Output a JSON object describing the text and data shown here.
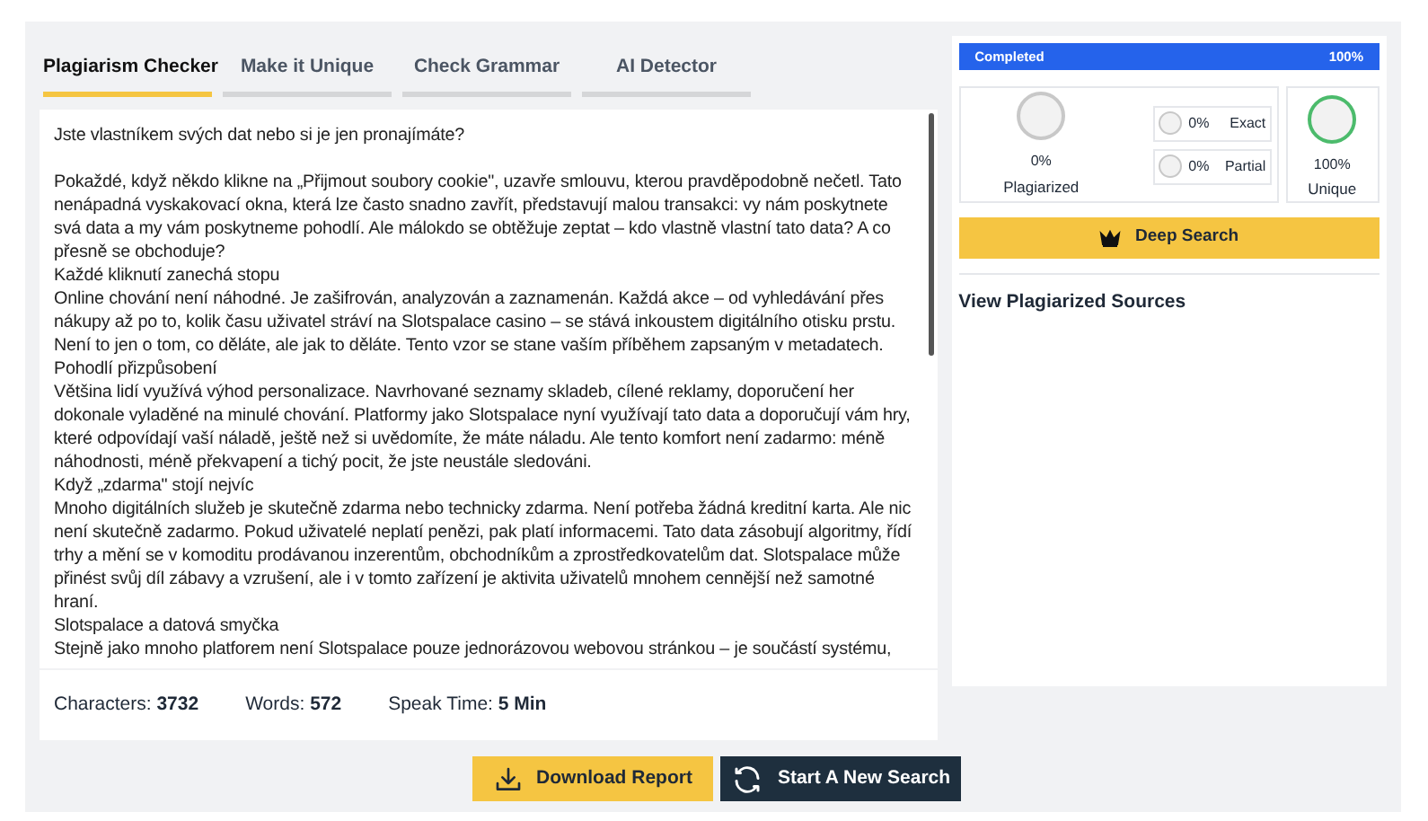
{
  "tabs": [
    {
      "label": "Plagiarism Checker",
      "selected": true
    },
    {
      "label": "Make it Unique",
      "selected": false
    },
    {
      "label": "Check Grammar",
      "selected": false
    },
    {
      "label": "AI Detector",
      "selected": false
    }
  ],
  "text": {
    "paragraphs": [
      "Jste vlastníkem svých dat nebo si je jen pronajímáte?",
      "Pokaždé, když někdo klikne na „Přijmout soubory cookie\", uzavře smlouvu, kterou pravděpodobně nečetl. Tato nenápadná vyskakovací okna, která lze často snadno zavřít, představují malou transakci: vy nám poskytnete svá data a my vám poskytneme pohodlí. Ale málokdo se obtěžuje zeptat – kdo vlastně vlastní tato data? A co přesně se obchoduje?",
      "Každé kliknutí zanechá stopu",
      "Online chování není náhodné. Je zašifrován, analyzován a zaznamenán. Každá akce – od vyhledávání přes nákupy až po to, kolik času uživatel stráví na Slotspalace casino – se stává inkoustem digitálního otisku prstu. Není to jen o tom, co děláte, ale jak to děláte. Tento vzor se stane vaším příběhem zapsaným v metadatech.",
      "Pohodlí přizpůsobení",
      "Většina lidí využívá výhod personalizace. Navrhované  seznamy skladeb, cílené reklamy, doporučení her dokonale vyladěné na minulé chování. Platformy jako Slotspalace nyní využívají tato data a doporučují vám hry, které odpovídají vaší náladě, ještě než si uvědomíte, že máte náladu. Ale tento komfort není zadarmo: méně náhodnosti, méně překvapení a tichý pocit, že jste neustále sledováni.",
      "Když „zdarma\" stojí nejvíc",
      "Mnoho digitálních služeb je skutečně zdarma nebo technicky zdarma. Není potřeba žádná kreditní karta. Ale nic není skutečně zadarmo. Pokud uživatelé neplatí penězi, pak platí informacemi. Tato data zásobují algoritmy, řídí trhy a mění se v komoditu prodávanou inzerentům, obchodníkům a zprostředkovatelům dat. Slotspalace může přinést svůj díl zábavy a vzrušení, ale i v tomto zařízení je aktivita uživatelů mnohem cennější než samotné hraní.",
      "Slotspalace a datová smyčka",
      "Stejně jako mnoho platforem není Slotspalace pouze jednorázovou webovou stránkou – je součástí systému,"
    ]
  },
  "stats": [
    {
      "label": "Characters:",
      "value": "3732"
    },
    {
      "label": "Words:",
      "value": "572"
    },
    {
      "label": "Speak Time:",
      "value": "5 Min"
    }
  ],
  "buttons": [
    {
      "kind": "download",
      "label": "Download Report"
    },
    {
      "kind": "restart",
      "label": "Start A New Search"
    }
  ],
  "progress": {
    "label": "Completed",
    "reading": "100%",
    "level": 1
  },
  "plagiarized": {
    "value": "0%",
    "label": "Plagiarized"
  },
  "matches": [
    {
      "value": "0%",
      "label": "Exact"
    },
    {
      "value": "0%",
      "label": "Partial"
    }
  ],
  "unique": {
    "value": "100%",
    "label": "Unique"
  },
  "deep_search": "Deep Search",
  "sources_title": "View Plagiarized Sources"
}
